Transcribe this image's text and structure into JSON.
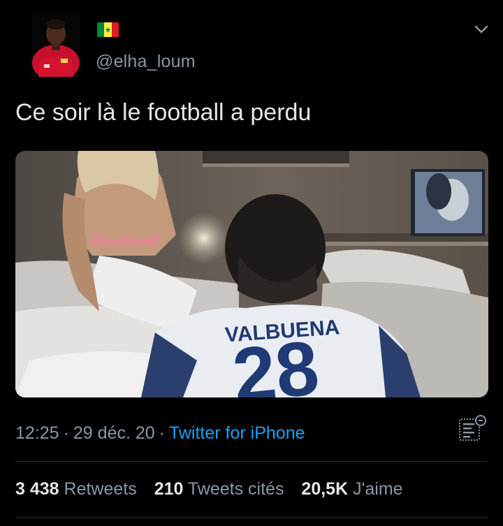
{
  "tweet": {
    "handle": "@elha_loum",
    "text": "Ce soir là le football a perdu",
    "time": "12:25",
    "date": "29 déc. 20",
    "separator": "·",
    "source": "Twitter for iPhone"
  },
  "stats": {
    "retweets_count": "3 438",
    "retweets_label": "Retweets",
    "quotes_count": "210",
    "quotes_label": "Tweets cités",
    "likes_count": "20,5K",
    "likes_label": "J'aime"
  },
  "image_caption": {
    "jersey_name": "VALBUENA",
    "jersey_number": "28"
  },
  "icons": {
    "avatar": "profile-photo-red-jersey",
    "flag": "senegal-flag",
    "chevron": "chevron-down-icon",
    "analytics": "analytics-icon"
  },
  "colors": {
    "background": "#000000",
    "text": "#e6e6e6",
    "muted": "#8899a6",
    "link": "#1da1f2",
    "divider": "#2a2f33"
  }
}
